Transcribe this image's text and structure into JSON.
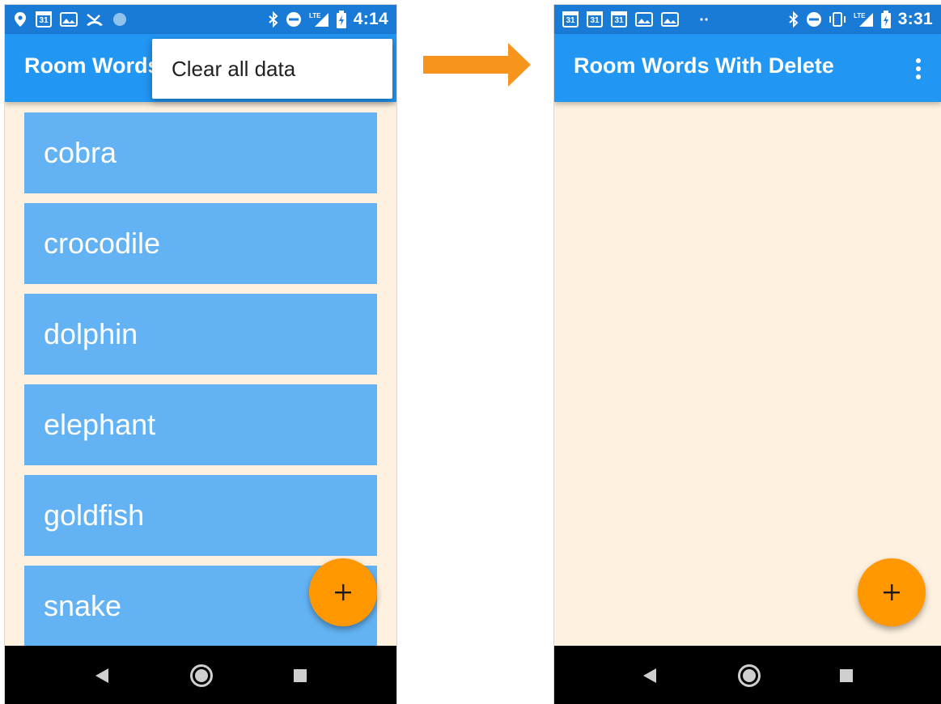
{
  "before_screen": {
    "status_bar": {
      "time": "4:14",
      "icons_left": [
        "location-pin-icon",
        "calendar-icon",
        "gallery-icon",
        "missed-call-icon",
        "circle-icon"
      ],
      "calendar_day": "31",
      "icons_right": [
        "bluetooth-icon",
        "do-not-disturb-icon",
        "lte-signal-icon",
        "battery-icon"
      ],
      "lte_label": "LTE"
    },
    "app_bar": {
      "title": "Room Words With Delete"
    },
    "overflow_menu": {
      "items": [
        {
          "label": "Clear all data"
        }
      ]
    },
    "words": [
      "cobra",
      "crocodile",
      "dolphin",
      "elephant",
      "goldfish",
      "snake"
    ],
    "fab": {
      "label": "+"
    }
  },
  "transition": {
    "icon": "right-arrow-icon"
  },
  "after_screen": {
    "status_bar": {
      "time": "3:31",
      "icons_left": [
        "calendar-icon",
        "calendar-icon",
        "calendar-icon",
        "gallery-icon",
        "gallery-icon",
        "more-dots-icon"
      ],
      "calendar_day": "31",
      "icons_right": [
        "bluetooth-icon",
        "do-not-disturb-icon",
        "vibrate-icon",
        "lte-signal-icon",
        "battery-icon"
      ],
      "lte_label": "LTE"
    },
    "app_bar": {
      "title": "Room Words With Delete"
    },
    "words": [],
    "fab": {
      "label": "+"
    }
  },
  "colors": {
    "status_bar": "#1A7BD6",
    "app_bar": "#2196F3",
    "background": "#FEF1DF",
    "word_item": "#63B3F4",
    "fab": "#FF9800",
    "arrow": "#F7941D",
    "nav_bar": "#000000"
  }
}
